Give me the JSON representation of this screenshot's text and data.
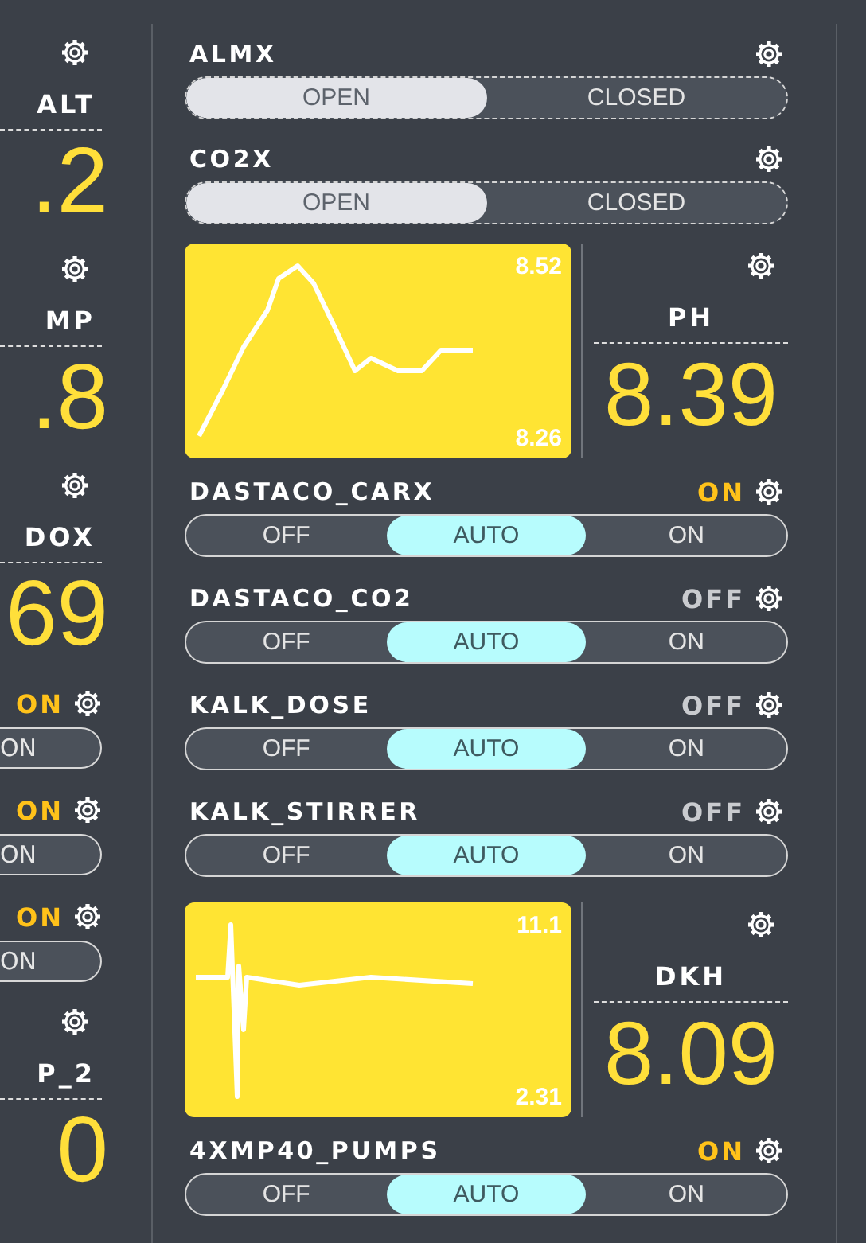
{
  "left_column": [
    {
      "kind": "sensor",
      "title": "ALT",
      "value": ".2"
    },
    {
      "kind": "sensor",
      "title": "MP",
      "value": ".8"
    },
    {
      "kind": "sensor",
      "title": "DOX",
      "value": "69"
    },
    {
      "kind": "switch",
      "status": "ON",
      "status_on": true,
      "option": "ON"
    },
    {
      "kind": "switch",
      "status": "ON",
      "status_on": true,
      "option": "ON"
    },
    {
      "kind": "switch",
      "status": "ON",
      "status_on": true,
      "option": "ON"
    },
    {
      "kind": "sensor",
      "title": "P_2",
      "value": "0"
    }
  ],
  "main_column": [
    {
      "kind": "valve",
      "title": "ALMX",
      "options": [
        {
          "label": "OPEN",
          "selected": true
        },
        {
          "label": "CLOSED",
          "selected": false
        }
      ]
    },
    {
      "kind": "valve",
      "title": "CO2X",
      "options": [
        {
          "label": "OPEN",
          "selected": true
        },
        {
          "label": "CLOSED",
          "selected": false
        }
      ]
    },
    {
      "kind": "chart_sensor",
      "chart": {
        "max_label": "8.52",
        "min_label": "8.26"
      },
      "title": "PH",
      "value": "8.39"
    },
    {
      "kind": "switch",
      "title": "DASTACO_CARX",
      "status": "ON",
      "status_on": true,
      "options": [
        {
          "label": "OFF",
          "selected": false
        },
        {
          "label": "AUTO",
          "selected": true
        },
        {
          "label": "ON",
          "selected": false
        }
      ]
    },
    {
      "kind": "switch",
      "title": "DASTACO_CO2",
      "status": "OFF",
      "status_on": false,
      "options": [
        {
          "label": "OFF",
          "selected": false
        },
        {
          "label": "AUTO",
          "selected": true
        },
        {
          "label": "ON",
          "selected": false
        }
      ]
    },
    {
      "kind": "switch",
      "title": "KALK_DOSE",
      "status": "OFF",
      "status_on": false,
      "options": [
        {
          "label": "OFF",
          "selected": false
        },
        {
          "label": "AUTO",
          "selected": true
        },
        {
          "label": "ON",
          "selected": false
        }
      ]
    },
    {
      "kind": "switch",
      "title": "KALK_STIRRER",
      "status": "OFF",
      "status_on": false,
      "options": [
        {
          "label": "OFF",
          "selected": false
        },
        {
          "label": "AUTO",
          "selected": true
        },
        {
          "label": "ON",
          "selected": false
        }
      ]
    },
    {
      "kind": "chart_sensor",
      "chart": {
        "max_label": "11.1",
        "min_label": "2.31"
      },
      "title": "DKH",
      "value": "8.09"
    },
    {
      "kind": "switch",
      "title": "4XMP40_PUMPS",
      "status": "ON",
      "status_on": true,
      "options": [
        {
          "label": "OFF",
          "selected": false
        },
        {
          "label": "AUTO",
          "selected": true
        },
        {
          "label": "ON",
          "selected": false
        }
      ]
    }
  ]
}
